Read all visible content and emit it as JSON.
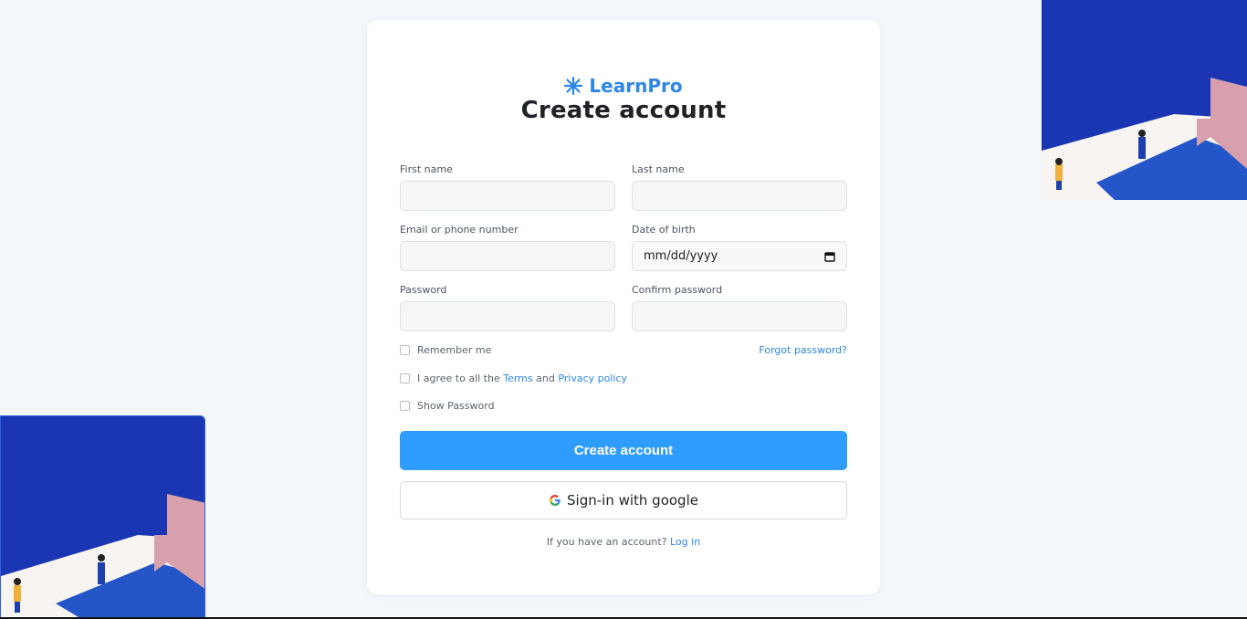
{
  "brand": {
    "name": "LearnPro",
    "icon": "asterisk-logo-icon",
    "color": "#2d86e8"
  },
  "title": "Create account",
  "fields": {
    "first_name": {
      "label": "First name",
      "value": ""
    },
    "last_name": {
      "label": "Last name",
      "value": ""
    },
    "email": {
      "label": "Email or phone number",
      "value": ""
    },
    "dob": {
      "label": "Date of birth",
      "placeholder": "mm/dd/yyyy"
    },
    "password": {
      "label": "Password",
      "value": ""
    },
    "confirm_password": {
      "label": "Confirm password",
      "value": ""
    }
  },
  "options": {
    "remember_me": "Remember me",
    "forgot_password": "Forgot password?",
    "agree_prefix": "I agree to all the",
    "terms": "Terms",
    "and": "and",
    "privacy": "Privacy policy",
    "show_password": "Show Password"
  },
  "buttons": {
    "create": "Create account",
    "google": "Sign-in with google"
  },
  "footer": {
    "text": "If you have an account?",
    "login": "Log in"
  },
  "colors": {
    "primary": "#2f9cff",
    "link": "#2d86e8",
    "background": "#f3f6fb"
  }
}
